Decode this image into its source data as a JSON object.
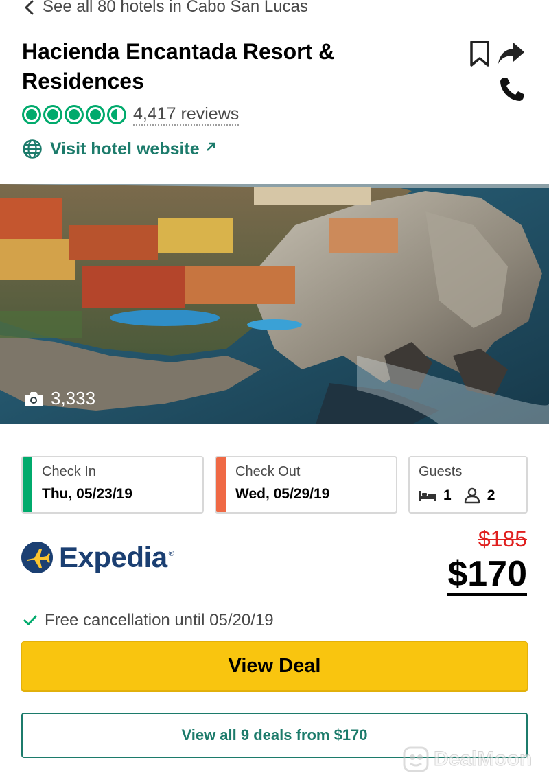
{
  "nav": {
    "back_label": "See all 80 hotels in Cabo San Lucas"
  },
  "hotel": {
    "name": "Hacienda Encantada Resort & Residences",
    "rating": 4.5,
    "reviews_label": "4,417 reviews",
    "website_label": "Visit hotel website",
    "photo_count": "3,333"
  },
  "stay": {
    "check_in_label": "Check In",
    "check_in_value": "Thu, 05/23/19",
    "check_out_label": "Check Out",
    "check_out_value": "Wed, 05/29/19",
    "guests_label": "Guests",
    "rooms": "1",
    "adults": "2"
  },
  "deal": {
    "provider": "Expedia",
    "original_price": "$185",
    "price": "$170",
    "cancellation": "Free cancellation until 05/20/19",
    "view_deal_label": "View Deal",
    "view_all_label": "View all 9 deals from $170"
  },
  "watermark": {
    "text": "DealMoon"
  },
  "colors": {
    "brand_green": "#00aa6c",
    "link_teal": "#1c7b6b",
    "check_in_bar": "#00aa6c",
    "check_out_bar": "#ef6945",
    "cta_yellow": "#f9c50f",
    "strike_red": "#e0201f",
    "expedia_navy": "#1b3f72"
  },
  "icons": [
    "back-icon",
    "bookmark-icon",
    "share-icon",
    "phone-icon",
    "globe-icon",
    "external-link-icon",
    "camera-icon",
    "bed-icon",
    "person-icon",
    "checkmark-icon",
    "expedia-logo-icon",
    "dealmoon-logo-icon"
  ]
}
